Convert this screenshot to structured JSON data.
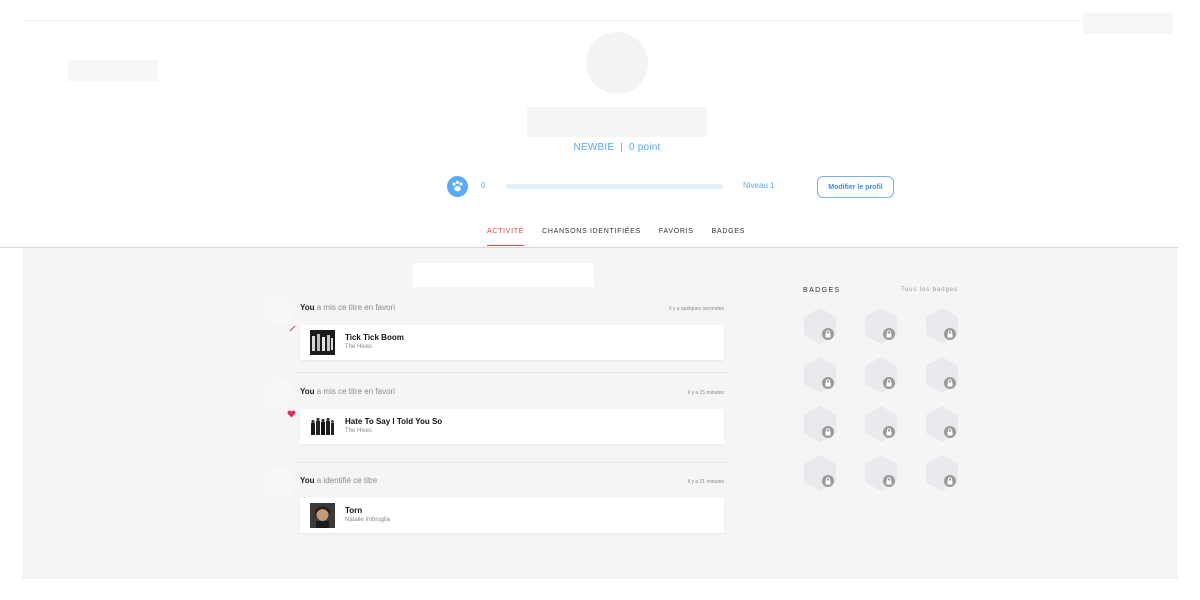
{
  "profile": {
    "rank": "NEWBIE",
    "rank_separator": "|",
    "points": "0 point",
    "level_value": "0",
    "level_label": "Niveau 1",
    "level_progress": 0.0,
    "edit_button": "Modifier le profil"
  },
  "tabs": [
    {
      "label": "ACTIVITÉ",
      "active": true
    },
    {
      "label": "CHANSONS IDENTIFIÉES",
      "active": false
    },
    {
      "label": "FAVORIS",
      "active": false
    },
    {
      "label": "BADGES",
      "active": false
    }
  ],
  "feed": [
    {
      "user": "You",
      "action": " a mis ce titre en favori",
      "time": "il y a quelques secondes",
      "title": "Tick Tick Boom",
      "artist": "The Hives",
      "mark": "pencil-icon"
    },
    {
      "user": "You",
      "action": " a mis ce titre en favori",
      "time": "il y a 15 minutes",
      "title": "Hate To Say I Told You So",
      "artist": "The Hives",
      "mark": "heart-icon"
    },
    {
      "user": "You",
      "action": " a identifié ce titre",
      "time": "il y a 21 minutes",
      "title": "Torn",
      "artist": "Natalie Imbruglia",
      "mark": ""
    }
  ],
  "badges": {
    "title": "BADGES",
    "link": "Tous les badges",
    "count": 12,
    "icon": "lock-icon"
  },
  "colors": {
    "accent": "#5aaaf4",
    "tab_active": "#e8453c",
    "badge_hex": "#e8eaed",
    "badge_lock": "#9a9a9a"
  }
}
